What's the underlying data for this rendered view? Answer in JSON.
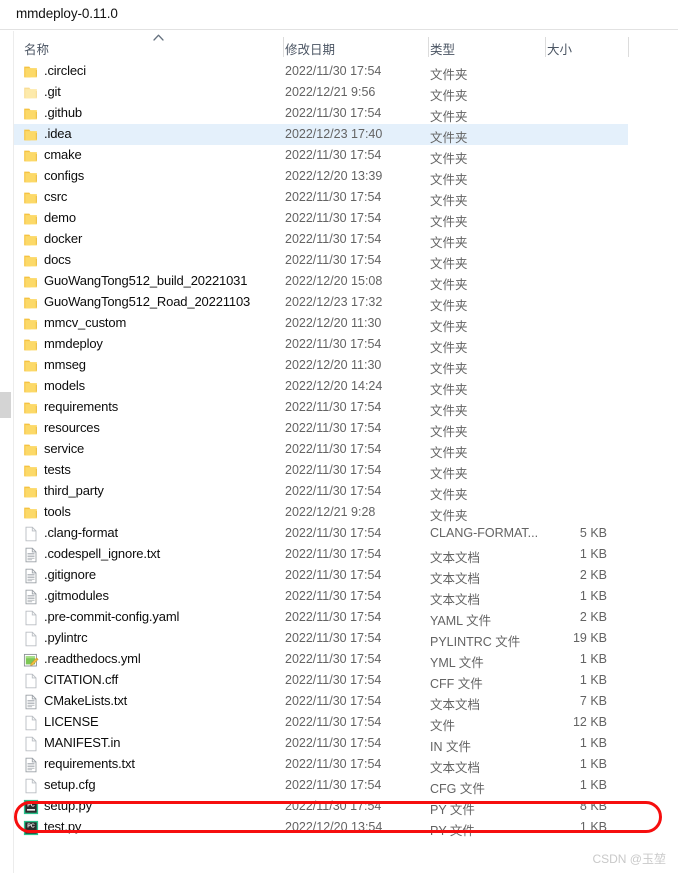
{
  "window": {
    "title": "mmdeploy-0.11.0"
  },
  "columns": {
    "name": "名称",
    "date_modified": "修改日期",
    "type": "类型",
    "size": "大小",
    "sort_caret": "⌃"
  },
  "watermark": {
    "text": "CSDN @玉堃"
  },
  "annotation": {
    "highlight_row_name": "setup.py",
    "color": "#f60e0e"
  },
  "colors": {
    "selection": "#e4f0fb",
    "folder": "#ffd34d",
    "text": "#0c0c0c",
    "muted": "#636363"
  },
  "rows": [
    {
      "icon": "folder-icon",
      "name": ".circleci",
      "date": "2022/11/30 17:54",
      "type": "文件夹",
      "size": "",
      "selected": false
    },
    {
      "icon": "folder-faded-icon",
      "name": ".git",
      "date": "2022/12/21 9:56",
      "type": "文件夹",
      "size": "",
      "selected": false
    },
    {
      "icon": "folder-icon",
      "name": ".github",
      "date": "2022/11/30 17:54",
      "type": "文件夹",
      "size": "",
      "selected": false
    },
    {
      "icon": "folder-icon",
      "name": ".idea",
      "date": "2022/12/23 17:40",
      "type": "文件夹",
      "size": "",
      "selected": true
    },
    {
      "icon": "folder-icon",
      "name": "cmake",
      "date": "2022/11/30 17:54",
      "type": "文件夹",
      "size": "",
      "selected": false
    },
    {
      "icon": "folder-icon",
      "name": "configs",
      "date": "2022/12/20 13:39",
      "type": "文件夹",
      "size": "",
      "selected": false
    },
    {
      "icon": "folder-icon",
      "name": "csrc",
      "date": "2022/11/30 17:54",
      "type": "文件夹",
      "size": "",
      "selected": false
    },
    {
      "icon": "folder-icon",
      "name": "demo",
      "date": "2022/11/30 17:54",
      "type": "文件夹",
      "size": "",
      "selected": false
    },
    {
      "icon": "folder-icon",
      "name": "docker",
      "date": "2022/11/30 17:54",
      "type": "文件夹",
      "size": "",
      "selected": false
    },
    {
      "icon": "folder-icon",
      "name": "docs",
      "date": "2022/11/30 17:54",
      "type": "文件夹",
      "size": "",
      "selected": false
    },
    {
      "icon": "folder-icon",
      "name": "GuoWangTong512_build_20221031",
      "date": "2022/12/20 15:08",
      "type": "文件夹",
      "size": "",
      "selected": false
    },
    {
      "icon": "folder-icon",
      "name": "GuoWangTong512_Road_20221103",
      "date": "2022/12/23 17:32",
      "type": "文件夹",
      "size": "",
      "selected": false
    },
    {
      "icon": "folder-icon",
      "name": "mmcv_custom",
      "date": "2022/12/20 11:30",
      "type": "文件夹",
      "size": "",
      "selected": false
    },
    {
      "icon": "folder-icon",
      "name": "mmdeploy",
      "date": "2022/11/30 17:54",
      "type": "文件夹",
      "size": "",
      "selected": false
    },
    {
      "icon": "folder-icon",
      "name": "mmseg",
      "date": "2022/12/20 11:30",
      "type": "文件夹",
      "size": "",
      "selected": false
    },
    {
      "icon": "folder-icon",
      "name": "models",
      "date": "2022/12/20 14:24",
      "type": "文件夹",
      "size": "",
      "selected": false
    },
    {
      "icon": "folder-icon",
      "name": "requirements",
      "date": "2022/11/30 17:54",
      "type": "文件夹",
      "size": "",
      "selected": false
    },
    {
      "icon": "folder-icon",
      "name": "resources",
      "date": "2022/11/30 17:54",
      "type": "文件夹",
      "size": "",
      "selected": false
    },
    {
      "icon": "folder-icon",
      "name": "service",
      "date": "2022/11/30 17:54",
      "type": "文件夹",
      "size": "",
      "selected": false
    },
    {
      "icon": "folder-icon",
      "name": "tests",
      "date": "2022/11/30 17:54",
      "type": "文件夹",
      "size": "",
      "selected": false
    },
    {
      "icon": "folder-icon",
      "name": "third_party",
      "date": "2022/11/30 17:54",
      "type": "文件夹",
      "size": "",
      "selected": false
    },
    {
      "icon": "folder-icon",
      "name": "tools",
      "date": "2022/12/21 9:28",
      "type": "文件夹",
      "size": "",
      "selected": false
    },
    {
      "icon": "blank-file-icon",
      "name": ".clang-format",
      "date": "2022/11/30 17:54",
      "type": "CLANG-FORMAT...",
      "size": "5 KB",
      "selected": false
    },
    {
      "icon": "text-file-icon",
      "name": ".codespell_ignore.txt",
      "date": "2022/11/30 17:54",
      "type": "文本文档",
      "size": "1 KB",
      "selected": false
    },
    {
      "icon": "text-file-icon",
      "name": ".gitignore",
      "date": "2022/11/30 17:54",
      "type": "文本文档",
      "size": "2 KB",
      "selected": false
    },
    {
      "icon": "text-file-icon",
      "name": ".gitmodules",
      "date": "2022/11/30 17:54",
      "type": "文本文档",
      "size": "1 KB",
      "selected": false
    },
    {
      "icon": "blank-file-icon",
      "name": ".pre-commit-config.yaml",
      "date": "2022/11/30 17:54",
      "type": "YAML 文件",
      "size": "2 KB",
      "selected": false
    },
    {
      "icon": "blank-file-icon",
      "name": ".pylintrc",
      "date": "2022/11/30 17:54",
      "type": "PYLINTRC 文件",
      "size": "19 KB",
      "selected": false
    },
    {
      "icon": "notepad-icon",
      "name": ".readthedocs.yml",
      "date": "2022/11/30 17:54",
      "type": "YML 文件",
      "size": "1 KB",
      "selected": false
    },
    {
      "icon": "blank-file-icon",
      "name": "CITATION.cff",
      "date": "2022/11/30 17:54",
      "type": "CFF 文件",
      "size": "1 KB",
      "selected": false
    },
    {
      "icon": "text-file-icon",
      "name": "CMakeLists.txt",
      "date": "2022/11/30 17:54",
      "type": "文本文档",
      "size": "7 KB",
      "selected": false
    },
    {
      "icon": "blank-file-icon",
      "name": "LICENSE",
      "date": "2022/11/30 17:54",
      "type": "文件",
      "size": "12 KB",
      "selected": false
    },
    {
      "icon": "blank-file-icon",
      "name": "MANIFEST.in",
      "date": "2022/11/30 17:54",
      "type": "IN 文件",
      "size": "1 KB",
      "selected": false
    },
    {
      "icon": "text-file-icon",
      "name": "requirements.txt",
      "date": "2022/11/30 17:54",
      "type": "文本文档",
      "size": "1 KB",
      "selected": false
    },
    {
      "icon": "blank-file-icon",
      "name": "setup.cfg",
      "date": "2022/11/30 17:54",
      "type": "CFG 文件",
      "size": "1 KB",
      "selected": false
    },
    {
      "icon": "python-file-icon",
      "name": "setup.py",
      "date": "2022/11/30 17:54",
      "type": "PY 文件",
      "size": "8 KB",
      "selected": false
    },
    {
      "icon": "python-file-icon",
      "name": "test.py",
      "date": "2022/12/20 13:54",
      "type": "PY 文件",
      "size": "1 KB",
      "selected": false
    }
  ]
}
